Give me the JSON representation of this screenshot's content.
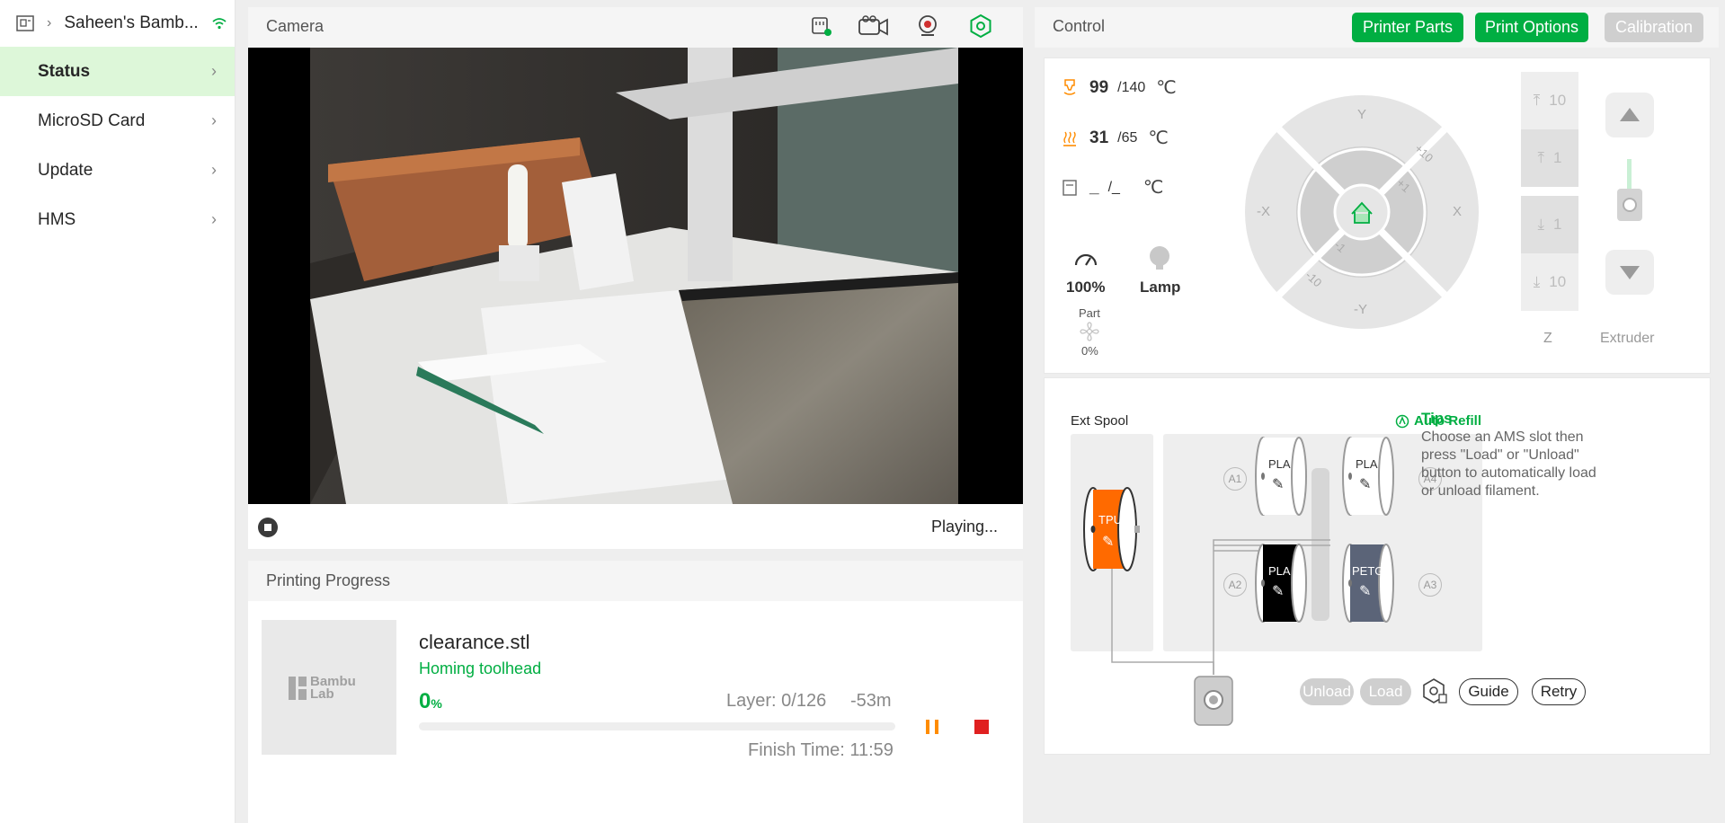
{
  "sidebar": {
    "device_name": "Saheen's Bamb...",
    "items": [
      {
        "label": "Status",
        "active": true
      },
      {
        "label": "MicroSD Card",
        "active": false
      },
      {
        "label": "Update",
        "active": false
      },
      {
        "label": "HMS",
        "active": false
      }
    ]
  },
  "camera": {
    "title": "Camera",
    "status": "Playing...",
    "icons": [
      "sd-card-icon",
      "video-camera-icon",
      "webcam-icon",
      "settings-hex-icon"
    ]
  },
  "progress": {
    "title": "Printing Progress",
    "thumb_brand_line1": "Bambu",
    "thumb_brand_line2": "Lab",
    "filename": "clearance.stl",
    "stage": "Homing toolhead",
    "percent": "0",
    "percent_unit": "%",
    "percent_value": 0,
    "layer": "Layer: 0/126",
    "remaining": "-53m",
    "finish_time": "Finish Time: 11:59"
  },
  "control": {
    "title": "Control",
    "buttons": {
      "printer_parts": "Printer Parts",
      "print_options": "Print Options",
      "calibration": "Calibration"
    },
    "nozzle": {
      "current": "99",
      "target": "/140",
      "unit": "℃"
    },
    "bed": {
      "current": "31",
      "target": "/65",
      "unit": "℃"
    },
    "chamber": {
      "current": "_",
      "target": "/_",
      "unit": "℃"
    },
    "speed": "100%",
    "lamp": "Lamp",
    "part_fan": {
      "label": "Part",
      "value": "0%"
    },
    "jog": {
      "y": "Y",
      "neg_y": "-Y",
      "x": "X",
      "neg_x": "-X",
      "p10": "+10",
      "p1": "+1",
      "m1": "-1",
      "m10": "-10"
    },
    "z_buttons": [
      "10",
      "1",
      "1",
      "10"
    ],
    "z_label": "Z",
    "extruder_label": "Extruder"
  },
  "ams": {
    "ext_spool": "Ext Spool",
    "ext_material": "TPU",
    "auto_refill": "Auto Refill",
    "slots": [
      {
        "id": "A1",
        "material": "PLA",
        "color": "#ffffff",
        "text_color": "#333333"
      },
      {
        "id": "A4",
        "material": "PLA",
        "color": "#ffffff",
        "text_color": "#333333"
      },
      {
        "id": "A2",
        "material": "PLA",
        "color": "#000000",
        "text_color": "#ffffff"
      },
      {
        "id": "A3",
        "material": "PETG",
        "color": "#5b6478",
        "text_color": "#ffffff"
      }
    ],
    "tips_title": "Tips",
    "tips_text": "Choose an AMS slot then press \"Load\" or \"Unload\" button to automatically load or unload filament.",
    "unload": "Unload",
    "load": "Load",
    "guide": "Guide",
    "retry": "Retry"
  },
  "colors": {
    "accent": "#00ae42",
    "tpu": "#ff6a00",
    "stop": "#e02020",
    "pause": "#ff8c00"
  }
}
